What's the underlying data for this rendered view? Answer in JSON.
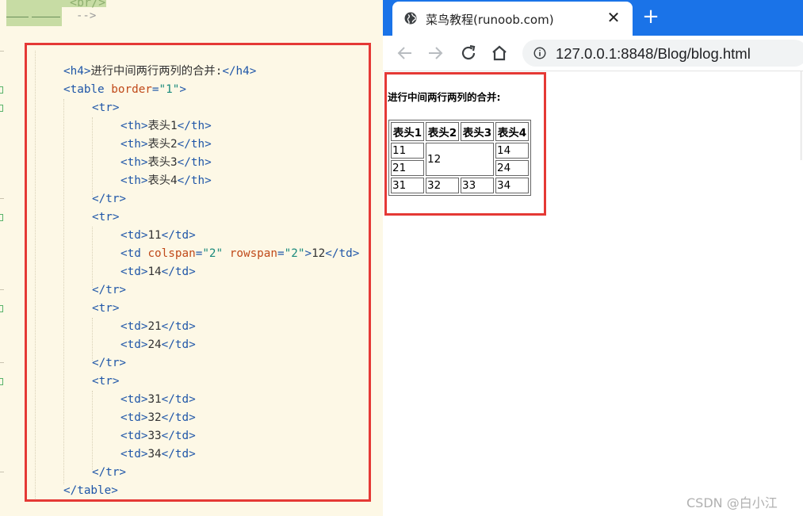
{
  "editor": {
    "top_snippet": {
      "br_tag": "<br/>",
      "comment_end": "-->"
    },
    "code_lines": [
      {
        "indent": 0,
        "parts": [
          [
            "t",
            "<h4>"
          ],
          [
            "x",
            "进行中间两行两列的合并:"
          ],
          [
            "t",
            "</h4>"
          ]
        ]
      },
      {
        "indent": 0,
        "parts": [
          [
            "t",
            "<table "
          ],
          [
            "a",
            "border"
          ],
          [
            "t",
            "="
          ],
          [
            "v",
            "\"1\""
          ],
          [
            "t",
            ">"
          ]
        ]
      },
      {
        "indent": 1,
        "parts": [
          [
            "t",
            "<tr>"
          ]
        ]
      },
      {
        "indent": 2,
        "parts": [
          [
            "t",
            "<th>"
          ],
          [
            "x",
            "表头1"
          ],
          [
            "t",
            "</th>"
          ]
        ]
      },
      {
        "indent": 2,
        "parts": [
          [
            "t",
            "<th>"
          ],
          [
            "x",
            "表头2"
          ],
          [
            "t",
            "</th>"
          ]
        ]
      },
      {
        "indent": 2,
        "parts": [
          [
            "t",
            "<th>"
          ],
          [
            "x",
            "表头3"
          ],
          [
            "t",
            "</th>"
          ]
        ]
      },
      {
        "indent": 2,
        "parts": [
          [
            "t",
            "<th>"
          ],
          [
            "x",
            "表头4"
          ],
          [
            "t",
            "</th>"
          ]
        ]
      },
      {
        "indent": 1,
        "parts": [
          [
            "t",
            "</tr>"
          ]
        ]
      },
      {
        "indent": 1,
        "parts": [
          [
            "t",
            "<tr>"
          ]
        ]
      },
      {
        "indent": 2,
        "parts": [
          [
            "t",
            "<td>"
          ],
          [
            "x",
            "11"
          ],
          [
            "t",
            "</td>"
          ]
        ]
      },
      {
        "indent": 2,
        "parts": [
          [
            "t",
            "<td "
          ],
          [
            "a",
            "colspan"
          ],
          [
            "t",
            "="
          ],
          [
            "v",
            "\"2\""
          ],
          [
            "t",
            " "
          ],
          [
            "a",
            "rowspan"
          ],
          [
            "t",
            "="
          ],
          [
            "v",
            "\"2\""
          ],
          [
            "t",
            ">"
          ],
          [
            "x",
            "12"
          ],
          [
            "t",
            "</td>"
          ]
        ]
      },
      {
        "indent": 2,
        "parts": [
          [
            "t",
            "<td>"
          ],
          [
            "x",
            "14"
          ],
          [
            "t",
            "</td>"
          ]
        ]
      },
      {
        "indent": 1,
        "parts": [
          [
            "t",
            "</tr>"
          ]
        ]
      },
      {
        "indent": 1,
        "parts": [
          [
            "t",
            "<tr>"
          ]
        ]
      },
      {
        "indent": 2,
        "parts": [
          [
            "t",
            "<td>"
          ],
          [
            "x",
            "21"
          ],
          [
            "t",
            "</td>"
          ]
        ]
      },
      {
        "indent": 2,
        "parts": [
          [
            "t",
            "<td>"
          ],
          [
            "x",
            "24"
          ],
          [
            "t",
            "</td>"
          ]
        ]
      },
      {
        "indent": 1,
        "parts": [
          [
            "t",
            "</tr>"
          ]
        ]
      },
      {
        "indent": 1,
        "parts": [
          [
            "t",
            "<tr>"
          ]
        ]
      },
      {
        "indent": 2,
        "parts": [
          [
            "t",
            "<td>"
          ],
          [
            "x",
            "31"
          ],
          [
            "t",
            "</td>"
          ]
        ]
      },
      {
        "indent": 2,
        "parts": [
          [
            "t",
            "<td>"
          ],
          [
            "x",
            "32"
          ],
          [
            "t",
            "</td>"
          ]
        ]
      },
      {
        "indent": 2,
        "parts": [
          [
            "t",
            "<td>"
          ],
          [
            "x",
            "33"
          ],
          [
            "t",
            "</td>"
          ]
        ]
      },
      {
        "indent": 2,
        "parts": [
          [
            "t",
            "<td>"
          ],
          [
            "x",
            "34"
          ],
          [
            "t",
            "</td>"
          ]
        ]
      },
      {
        "indent": 1,
        "parts": [
          [
            "t",
            "</tr>"
          ]
        ]
      },
      {
        "indent": 0,
        "parts": [
          [
            "t",
            "</table>"
          ]
        ]
      }
    ],
    "syntax_colors": {
      "tag": "#1f56a8",
      "attribute": "#c04a1a",
      "value": "#1a8a7c",
      "text": "#333333"
    },
    "highlight_color": "#e53935"
  },
  "browser": {
    "tab_title": "菜鸟教程(runoob.com)",
    "tab_icon": "globe-icon",
    "close_icon": "close-icon",
    "new_tab_icon": "plus-icon",
    "url": "127.0.0.1:8848/Blog/blog.html",
    "accent_color": "#1a73e8",
    "page": {
      "heading": "进行中间两行两列的合并:",
      "table": {
        "headers": [
          "表头1",
          "表头2",
          "表头3",
          "表头4"
        ],
        "rows": [
          [
            "11",
            "12",
            "14"
          ],
          [
            "21",
            "24"
          ],
          [
            "31",
            "32",
            "33",
            "34"
          ]
        ],
        "merged_cell": {
          "value": "12",
          "colspan": 2,
          "rowspan": 2
        }
      }
    }
  },
  "watermark": "CSDN @白小江"
}
